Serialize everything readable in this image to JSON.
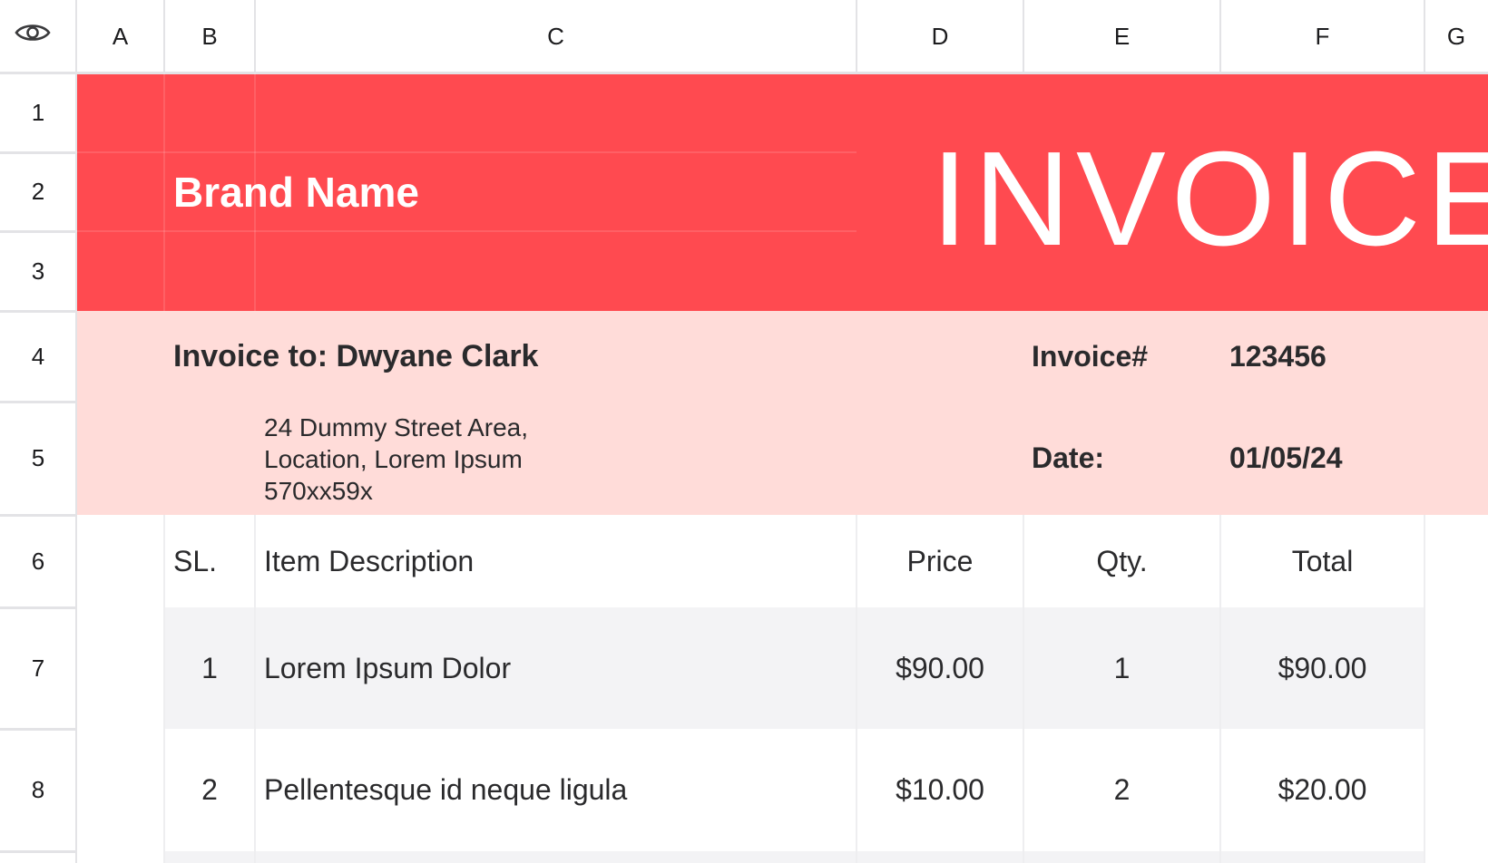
{
  "columns": [
    "A",
    "B",
    "C",
    "D",
    "E",
    "F",
    "G"
  ],
  "rows": [
    "1",
    "2",
    "3",
    "4",
    "5",
    "6",
    "7",
    "8"
  ],
  "header": {
    "brand": "Brand Name",
    "title": "INVOICE"
  },
  "bill_to": {
    "label": "Invoice to: Dwyane Clark",
    "address": [
      "24 Dummy Street Area,",
      "Location, Lorem Ipsum",
      "570xx59x"
    ],
    "invoice_label": "Invoice#",
    "invoice_value": "123456",
    "date_label": "Date:",
    "date_value": "01/05/24"
  },
  "table": {
    "headers": [
      "SL.",
      "Item Description",
      "Price",
      "Qty.",
      "Total"
    ],
    "rows": [
      [
        "1",
        "Lorem Ipsum Dolor",
        "$90.00",
        "1",
        "$90.00"
      ],
      [
        "2",
        "Pellentesque id neque ligula",
        "$10.00",
        "2",
        "$20.00"
      ]
    ]
  },
  "colors": {
    "header_red": "#ff4a50",
    "info_pink": "#ffdcd9",
    "row_grey": "#f3f3f5"
  },
  "icons": {
    "corner": "eye-icon"
  }
}
